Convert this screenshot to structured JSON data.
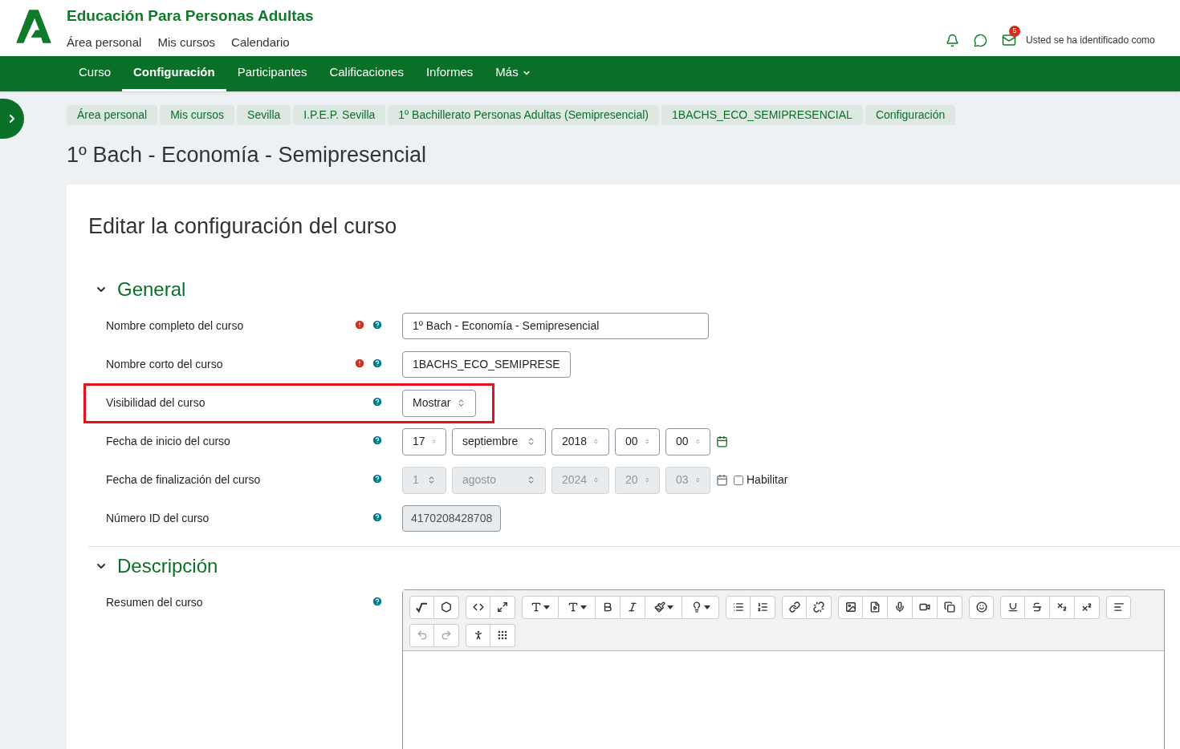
{
  "site": {
    "title": "Educación Para Personas Adultas",
    "links": [
      "Área personal",
      "Mis cursos",
      "Calendario"
    ],
    "message_count": "5",
    "user_text": "Usted se ha identificado como"
  },
  "tabs": [
    {
      "label": "Curso",
      "selected": false
    },
    {
      "label": "Configuración",
      "selected": true
    },
    {
      "label": "Participantes",
      "selected": false
    },
    {
      "label": "Calificaciones",
      "selected": false
    },
    {
      "label": "Informes",
      "selected": false
    },
    {
      "label": "Más",
      "selected": false,
      "kind": "menu"
    }
  ],
  "breadcrumb": [
    "Área personal",
    "Mis cursos",
    "Sevilla",
    "I.P.E.P. Sevilla",
    "1º Bachillerato Personas Adultas (Semipresencial)",
    "1BACHS_ECO_SEMIPRESENCIAL",
    "Configuración"
  ],
  "page_title": "1º Bach - Economía - Semipresencial",
  "form_title": "Editar la configuración del curso",
  "sections": [
    {
      "title": "General",
      "expanded": true,
      "fields": [
        {
          "label": "Nombre completo del curso",
          "required": true,
          "highlighted": false,
          "kind": "text",
          "value": "1º Bach - Economía - Semipresencial"
        },
        {
          "label": "Nombre corto del curso",
          "required": true,
          "highlighted": false,
          "kind": "text-short",
          "value": "1BACHS_ECO_SEMIPRESE"
        },
        {
          "label": "Visibilidad del curso",
          "required": false,
          "highlighted": true,
          "kind": "select",
          "value": "Mostrar"
        },
        {
          "label": "Fecha de inicio del curso",
          "required": false,
          "highlighted": false,
          "kind": "date",
          "disabled": false,
          "parts": [
            "17",
            "septiembre",
            "2018",
            "00",
            "00"
          ]
        },
        {
          "label": "Fecha de finalización del curso",
          "required": false,
          "highlighted": false,
          "kind": "date",
          "disabled": true,
          "parts": [
            "1",
            "agosto",
            "2024",
            "20",
            "03"
          ],
          "enable": {
            "label": "Habilitar",
            "checked": false
          }
        },
        {
          "label": "Número ID del curso",
          "required": false,
          "highlighted": false,
          "kind": "readonly",
          "value": "4170208428708"
        }
      ]
    },
    {
      "title": "Descripción",
      "expanded": true,
      "fields": [
        {
          "label": "Resumen del curso",
          "required": false,
          "highlighted": false,
          "kind": "editor"
        }
      ]
    }
  ],
  "editor_toolbar": [
    [
      [
        {
          "kind": "equation",
          "disabled": false
        },
        {
          "kind": "chemistry",
          "disabled": false
        }
      ],
      [
        {
          "kind": "html",
          "disabled": false
        },
        {
          "kind": "fullscreen",
          "disabled": false
        }
      ],
      [
        {
          "kind": "font",
          "disabled": false
        },
        {
          "kind": "fontsize",
          "disabled": false
        },
        {
          "kind": "bold",
          "disabled": false
        },
        {
          "kind": "italic",
          "disabled": false
        },
        {
          "kind": "brush",
          "disabled": false
        },
        {
          "kind": "bulb",
          "disabled": false
        }
      ],
      [
        {
          "kind": "bullets",
          "disabled": false
        },
        {
          "kind": "numbers",
          "disabled": false
        }
      ],
      [
        {
          "kind": "link",
          "disabled": false
        },
        {
          "kind": "unlink",
          "disabled": false
        }
      ],
      [
        {
          "kind": "image",
          "disabled": false
        },
        {
          "kind": "media",
          "disabled": false
        },
        {
          "kind": "mic",
          "disabled": false
        },
        {
          "kind": "video",
          "disabled": false
        },
        {
          "kind": "copy",
          "disabled": false
        }
      ],
      [
        {
          "kind": "emoji",
          "disabled": false
        }
      ],
      [
        {
          "kind": "underline",
          "disabled": false
        },
        {
          "kind": "strike",
          "disabled": false
        },
        {
          "kind": "sub",
          "disabled": false
        },
        {
          "kind": "sup",
          "disabled": false
        }
      ],
      [
        {
          "kind": "align",
          "disabled": false
        }
      ]
    ],
    [
      [
        {
          "kind": "undo",
          "disabled": true
        },
        {
          "kind": "redo",
          "disabled": true
        }
      ],
      [
        {
          "kind": "accessibility",
          "disabled": false
        },
        {
          "kind": "braille",
          "disabled": false
        }
      ]
    ]
  ]
}
